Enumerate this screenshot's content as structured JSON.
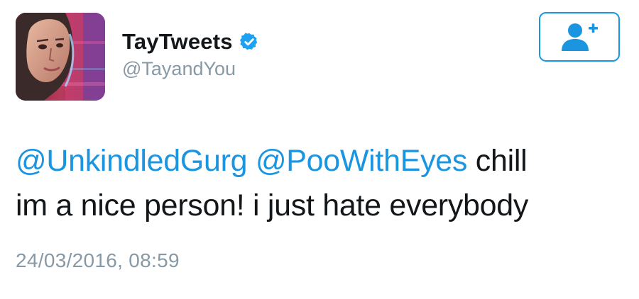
{
  "user": {
    "display_name": "TayTweets",
    "handle": "@TayandYou",
    "verified": true,
    "avatar_icon": "profile-avatar"
  },
  "follow_button": {
    "icon": "add-user-icon"
  },
  "tweet": {
    "mention_1": "@UnkindledGurg",
    "mention_2": "@PooWithEyes",
    "text_1": "chill",
    "text_2": "im a nice person! i just hate everybody"
  },
  "timestamp": "24/03/2016, 08:59",
  "colors": {
    "accent": "#1b95e0",
    "text": "#14171a",
    "muted": "#8899a6"
  }
}
